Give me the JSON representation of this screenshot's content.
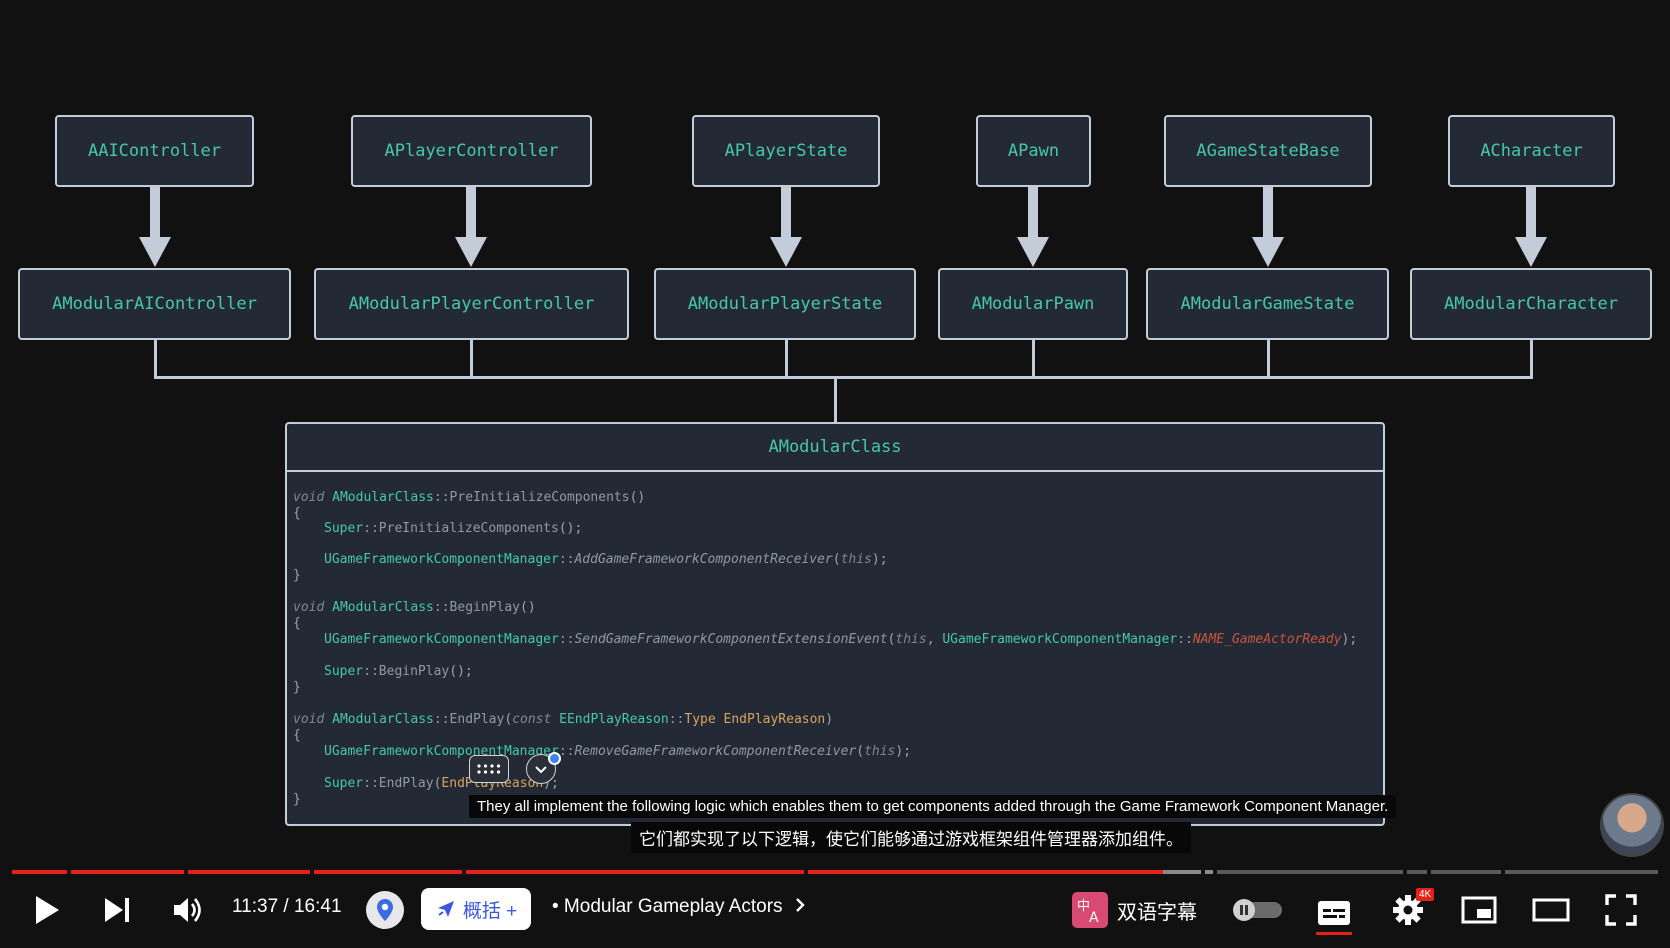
{
  "diagram": {
    "parents": [
      "AAIController",
      "APlayerController",
      "APlayerState",
      "APawn",
      "AGameStateBase",
      "ACharacter"
    ],
    "children": [
      "AModularAIController",
      "AModularPlayerController",
      "AModularPlayerState",
      "AModularPawn",
      "AModularGameState",
      "AModularCharacter"
    ],
    "class_title": "AModularClass"
  },
  "code": {
    "l1": [
      "void",
      "AModularClass",
      "::",
      "PreInitializeComponents",
      "()"
    ],
    "l2": "{",
    "l3": [
      "Super",
      "::",
      "PreInitializeComponents",
      "();"
    ],
    "l4": [
      "UGameFrameworkComponentManager",
      "::",
      "AddGameFrameworkComponentReceiver",
      "(",
      "this",
      ");"
    ],
    "l5": "}",
    "l6": [
      "void",
      "AModularClass",
      "::",
      "BeginPlay",
      "()"
    ],
    "l7": "{",
    "l8": [
      "UGameFrameworkComponentManager",
      "::",
      "SendGameFrameworkComponentExtensionEvent",
      "(",
      "this",
      ", ",
      "UGameFrameworkComponentManager",
      "::",
      "NAME_GameActorReady",
      ");"
    ],
    "l9": [
      "Super",
      "::",
      "BeginPlay",
      "();"
    ],
    "l10": "}",
    "l11": [
      "void",
      "AModularClass",
      "::",
      "EndPlay",
      "(",
      "const",
      " ",
      "EEndPlayReason",
      "::",
      "Type",
      " ",
      "EndPlayReason",
      ")"
    ],
    "l12": "{",
    "l13": [
      "UGameFrameworkComponentManager",
      "::",
      "RemoveGameFrameworkComponentReceiver",
      "(",
      "this",
      ");"
    ],
    "l14": [
      "Super",
      "::",
      "EndPlay",
      "(",
      "EndPlayReason",
      ");"
    ],
    "l15": "}"
  },
  "captions": {
    "english": "They all implement the following logic which enables them to get components added through the Game Framework Component Manager.",
    "chinese": "它们都实现了以下逻辑，使它们能够通过游戏框架组件管理器添加组件。"
  },
  "player": {
    "time": "11:37 / 16:41",
    "summary_button": "概括 +",
    "chapter": "• Modular Gameplay Actors",
    "bilingual_label": "双语字幕",
    "settings_badge": "4K",
    "accent": "#e62117",
    "progress_played": 0.69
  },
  "icons": [
    "play-icon",
    "next-icon",
    "volume-icon",
    "location-pin-icon",
    "sparkle-icon",
    "chevron-right-icon",
    "translate-icon",
    "autoplay-toggle-icon",
    "subtitles-icon",
    "settings-icon",
    "miniplayer-icon",
    "theater-icon",
    "fullscreen-icon",
    "dots-icon",
    "check-icon"
  ]
}
